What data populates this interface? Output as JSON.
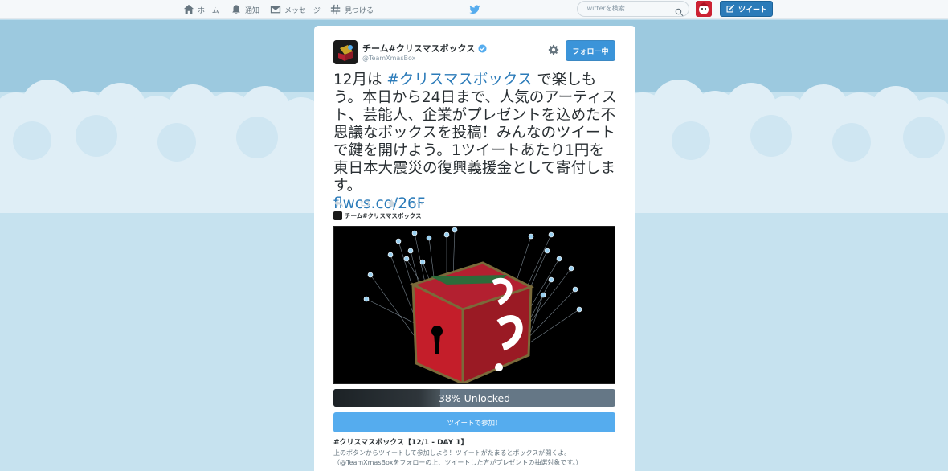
{
  "nav": {
    "home": "ホーム",
    "notifications": "通知",
    "messages": "メッセージ",
    "discover": "見つける",
    "search_placeholder": "Twitterを検索",
    "tweet_button": "ツイート"
  },
  "tweet": {
    "display_name": "チーム#クリスマスボックス",
    "handle": "@TeamXmasBox",
    "follow_label": "フォロー中",
    "text_part1": "12月は ",
    "hashtag": "#クリスマスボックス",
    "text_part2": " で楽しもう。本日から24日まで、人気のアーティスト、芸能人、企業がプレゼントを込めた不思議なボックスを投稿！みんなのツイートで鍵を開けよう。1ツイートあたり1円を東日本大震災の復興義援金として寄付します。",
    "link": "flwcs.co/26F"
  },
  "card": {
    "source_name": "チーム#クリスマスボックス",
    "progress_label": "38% Unlocked",
    "progress_fraction": 0.38,
    "join_label": "ツイートで参加！",
    "desc_title": "#クリスマスボックス【12/1 - DAY 1】",
    "desc_line1": "上のボタンからツイートして参加しよう！ツイートがたまるとボックスが開くよ。",
    "desc_line2": "（@TeamXmasBoxをフォローの上、ツイートした方がプレゼントの抽選対象です。）"
  },
  "colors": {
    "accent": "#55acee",
    "link": "#2b7bb9",
    "sky": "#c0deed"
  }
}
